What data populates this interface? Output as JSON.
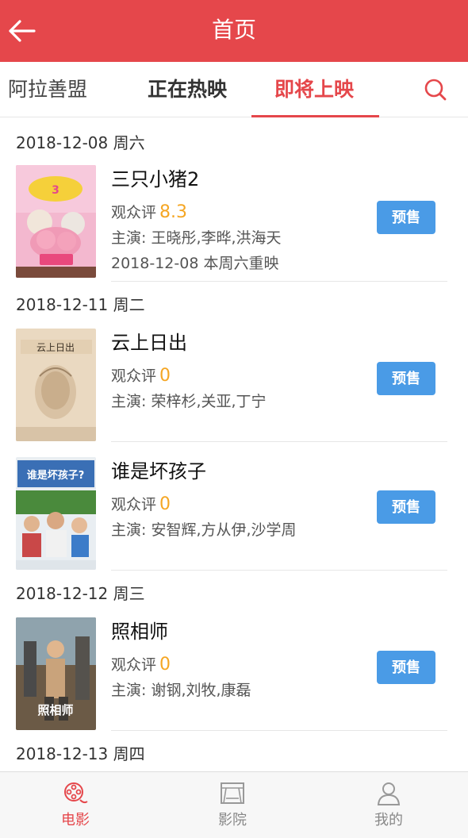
{
  "header": {
    "title": "首页",
    "back_icon": "arrow-left-icon"
  },
  "tabs": {
    "city": "阿拉善盟",
    "now_showing": "正在热映",
    "coming_soon": "即将上映",
    "search_icon": "search-icon"
  },
  "colors": {
    "brand": "#e5474b",
    "presale": "#4a9be6",
    "score": "#f5a623"
  },
  "groups": [
    {
      "date": "2018-12-08 周六"
    },
    {
      "date": "2018-12-11 周二"
    },
    {
      "date": "2018-12-12 周三"
    },
    {
      "date": "2018-12-13 周四"
    }
  ],
  "movies": [
    {
      "title": "三只小猪2",
      "score_label": "观众评",
      "score": "8.3",
      "cast": "主演: 王晓彤,李晔,洪海天",
      "extra": "2018-12-08 本周六重映",
      "button": "预售"
    },
    {
      "title": "云上日出",
      "score_label": "观众评",
      "score": "0",
      "cast": "主演: 荣梓杉,关亚,丁宁",
      "button": "预售"
    },
    {
      "title": "谁是坏孩子",
      "score_label": "观众评",
      "score": "0",
      "cast": "主演: 安智辉,方从伊,沙学周",
      "button": "预售"
    },
    {
      "title": "照相师",
      "score_label": "观众评",
      "score": "0",
      "cast": "主演: 谢钢,刘牧,康磊",
      "button": "预售"
    }
  ],
  "bottom_nav": [
    {
      "label": "电影",
      "icon": "film-reel-icon",
      "active": true
    },
    {
      "label": "影院",
      "icon": "cinema-screen-icon",
      "active": false
    },
    {
      "label": "我的",
      "icon": "user-icon",
      "active": false
    }
  ]
}
